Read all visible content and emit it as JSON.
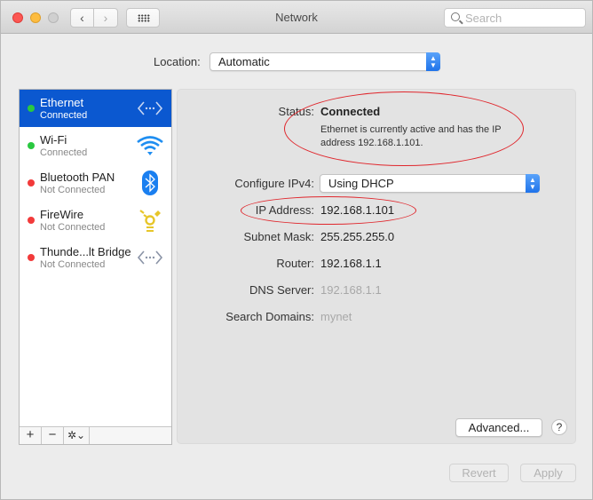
{
  "window": {
    "title": "Network",
    "search_placeholder": "Search",
    "nav": {
      "back_glyph": "‹",
      "forward_glyph": "›"
    }
  },
  "location": {
    "label": "Location:",
    "value": "Automatic"
  },
  "services": [
    {
      "name": "Ethernet",
      "status": "Connected",
      "status_color": "#2ac840",
      "icon": "ethernet-icon",
      "selected": true
    },
    {
      "name": "Wi-Fi",
      "status": "Connected",
      "status_color": "#2ac840",
      "icon": "wifi-icon",
      "selected": false
    },
    {
      "name": "Bluetooth PAN",
      "status": "Not Connected",
      "status_color": "#f23a3a",
      "icon": "bluetooth-icon",
      "selected": false
    },
    {
      "name": "FireWire",
      "status": "Not Connected",
      "status_color": "#f23a3a",
      "icon": "firewire-icon",
      "selected": false
    },
    {
      "name": "Thunde...lt Bridge",
      "status": "Not Connected",
      "status_color": "#f23a3a",
      "icon": "thunderbolt-bridge-icon",
      "selected": false
    }
  ],
  "sidebar_controls": {
    "add": "+",
    "remove": "−",
    "gear": "✲⌄"
  },
  "detail": {
    "status_label": "Status:",
    "status_value": "Connected",
    "status_description": "Ethernet is currently active and has the IP address 192.168.1.101.",
    "configure_label": "Configure IPv4:",
    "configure_value": "Using DHCP",
    "ip_label": "IP Address:",
    "ip_value": "192.168.1.101",
    "subnet_label": "Subnet Mask:",
    "subnet_value": "255.255.255.0",
    "router_label": "Router:",
    "router_value": "192.168.1.1",
    "dns_label": "DNS Server:",
    "dns_value": "192.168.1.1",
    "search_domains_label": "Search Domains:",
    "search_domains_value": "mynet",
    "advanced_button": "Advanced...",
    "help_button": "?"
  },
  "footer": {
    "revert_button": "Revert",
    "apply_button": "Apply"
  },
  "colors": {
    "selection": "#0b58d0",
    "annotation": "#e0262c",
    "connected": "#2ac840",
    "disconnected": "#f23a3a"
  }
}
